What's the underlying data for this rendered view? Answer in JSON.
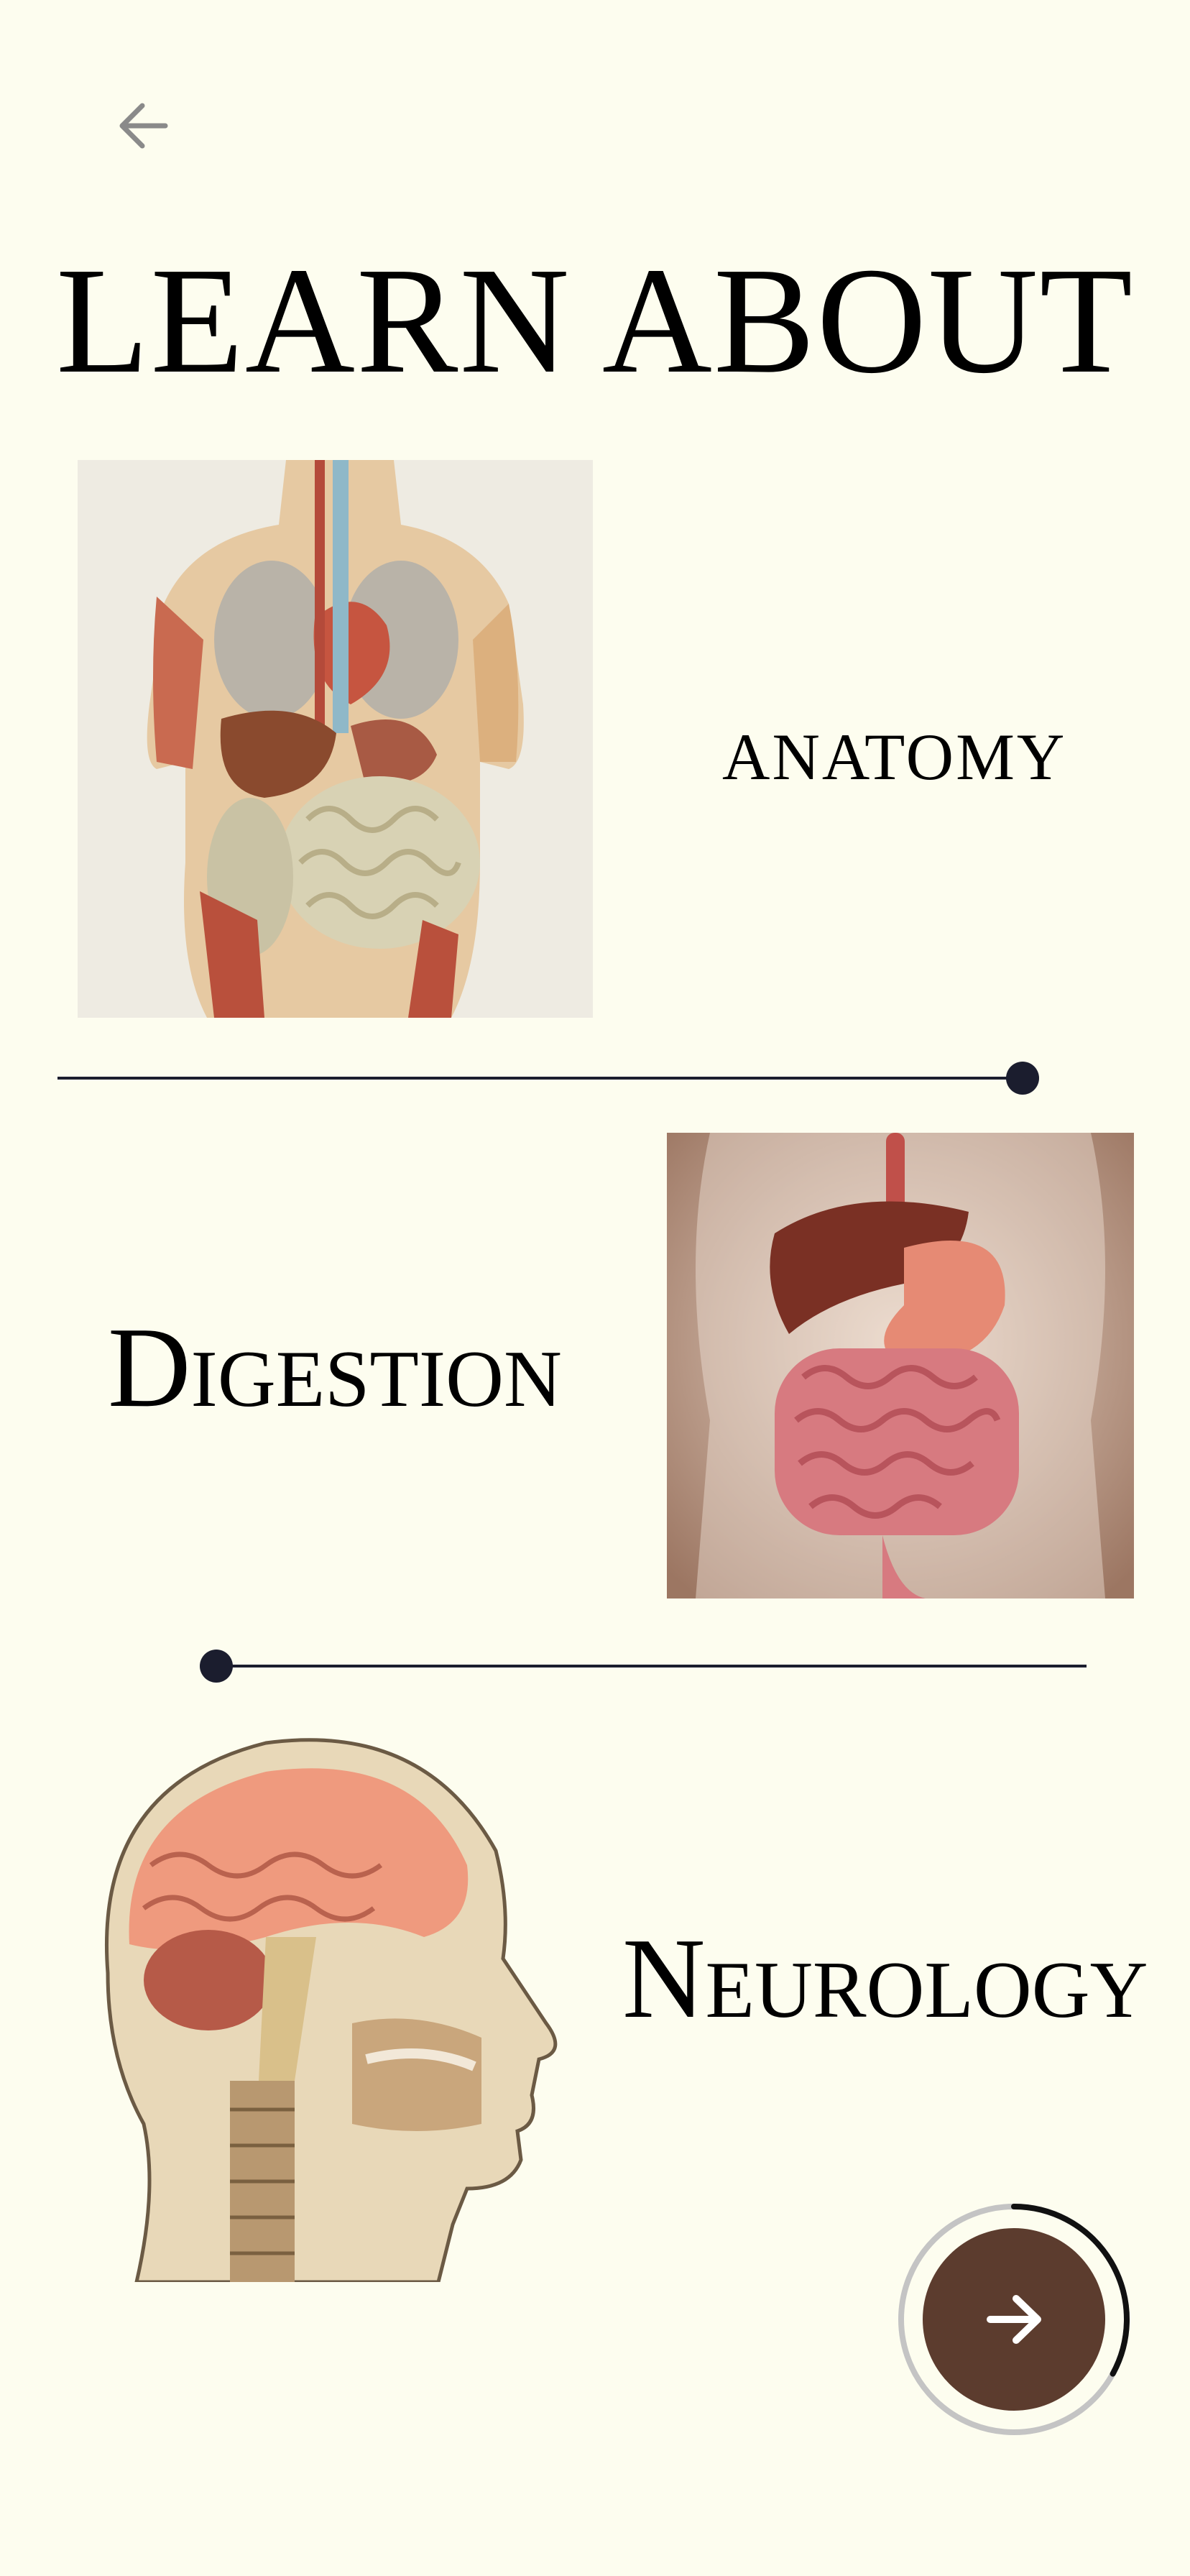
{
  "header": {
    "back_icon": "arrow-left-icon",
    "title": "LEARN ABOUT"
  },
  "topics": [
    {
      "label": "ANATOMY",
      "image": "human-torso-anatomy-illustration"
    },
    {
      "label": "Digestion",
      "image": "digestive-system-illustration"
    },
    {
      "label": "Neurology",
      "image": "head-brain-sagittal-illustration"
    }
  ],
  "footer": {
    "next_icon": "arrow-right-icon",
    "progress": 0.33
  },
  "colors": {
    "background": "#fdfdef",
    "accent": "#5c3c2e",
    "divider": "#1b1d2e",
    "icon_gray": "#8a8a8a"
  }
}
